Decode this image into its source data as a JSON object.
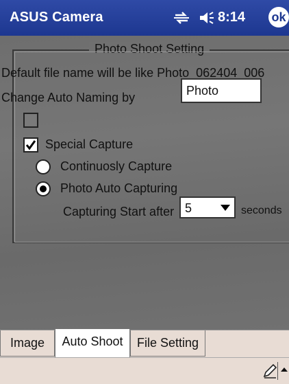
{
  "titlebar": {
    "app_title": "ASUS Camera",
    "time": "8:14",
    "ok_label": "ok"
  },
  "group": {
    "title": "Photo Shoot Setting",
    "default_name_text": "Default file name will be like Photo_062404_006",
    "auto_naming_label": "Change Auto Naming by",
    "auto_naming_value": "Photo",
    "unlabeled_checkbox_checked": false,
    "special_capture": {
      "label": "Special Capture",
      "checked": true
    },
    "options": [
      {
        "label": "Continuosly Capture",
        "selected": false
      },
      {
        "label": "Photo Auto Capturing",
        "selected": true
      }
    ],
    "start_after_label": "Capturing Start after",
    "start_after_value": "5",
    "seconds_label": "seconds"
  },
  "tabs": [
    {
      "label": "Image",
      "active": false
    },
    {
      "label": "Auto Shoot",
      "active": true
    },
    {
      "label": "File Setting",
      "active": false
    }
  ],
  "colors": {
    "titlebar": "#1d3790",
    "panel": "#707070",
    "tabstrip": "#e8dcd4"
  },
  "icons": [
    "connectivity-icon",
    "volume-icon",
    "pen-icon",
    "input-up-arrow-icon"
  ]
}
